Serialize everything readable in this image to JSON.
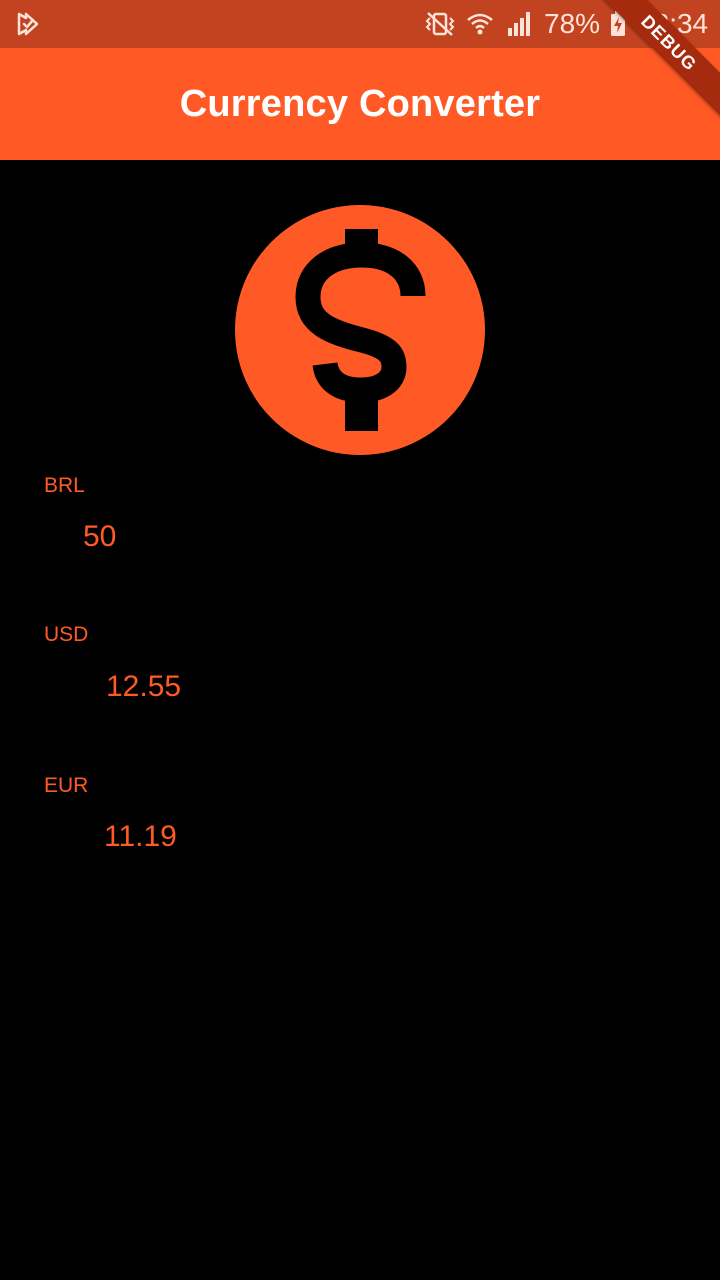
{
  "status_bar": {
    "battery_percent": "78%",
    "time": "22:34",
    "icons": [
      "play-store-notification-icon",
      "vibrate-mute-icon",
      "wifi-icon",
      "cell-signal-icon",
      "battery-charging-icon"
    ]
  },
  "app_bar": {
    "title": "Currency Converter"
  },
  "debug_banner": {
    "label": "DEBUG"
  },
  "hero": {
    "icon": "dollar-coin-icon"
  },
  "fields": {
    "brl": {
      "label": "BRL",
      "value": "50"
    },
    "usd": {
      "label": "USD",
      "value": "12.55"
    },
    "eur": {
      "label": "EUR",
      "value": "11.19"
    }
  },
  "colors": {
    "status_bar": "#C2431F",
    "primary": "#FF5A26",
    "background": "#000000",
    "app_title": "#FFFFFF"
  }
}
